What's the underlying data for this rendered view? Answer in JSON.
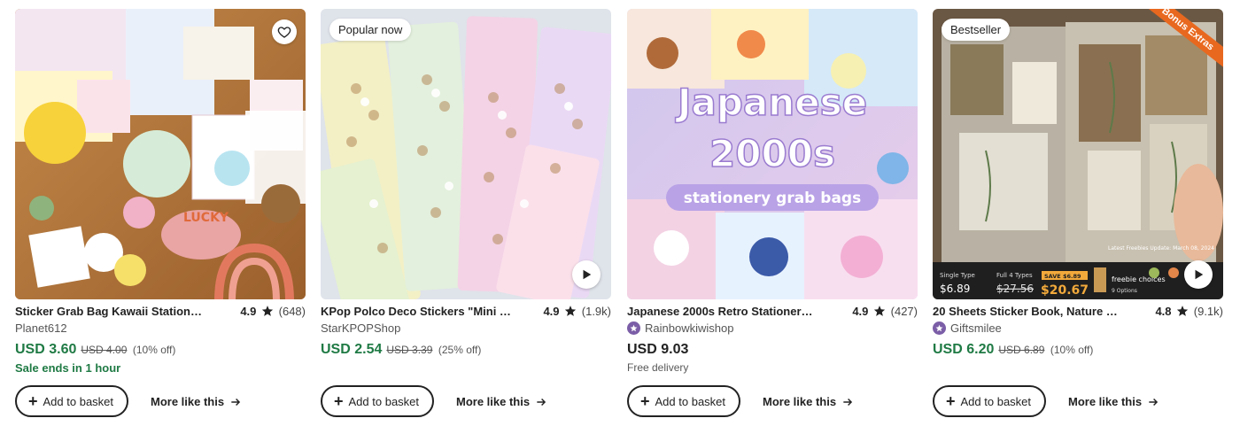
{
  "products": [
    {
      "badge": "",
      "has_favorite": true,
      "has_video": false,
      "ribbon": "",
      "title": "Sticker Grab Bag Kawaii Station…",
      "rating": "4.9",
      "review_count": "(648)",
      "shop": "Planet612",
      "star_seller": false,
      "price": "USD 3.60",
      "price_on_sale": true,
      "original_price": "USD 4.00",
      "discount": "(10% off)",
      "sub_text": "Sale ends in 1 hour",
      "sub_style": "green",
      "add_label": "Add to basket",
      "more_label": "More like this"
    },
    {
      "badge": "Popular now",
      "has_favorite": false,
      "has_video": true,
      "ribbon": "",
      "title": "KPop Polco Deco Stickers \"Mini …",
      "rating": "4.9",
      "review_count": "(1.9k)",
      "shop": "StarKPOPShop",
      "star_seller": false,
      "price": "USD 2.54",
      "price_on_sale": true,
      "original_price": "USD 3.39",
      "discount": "(25% off)",
      "sub_text": "",
      "sub_style": "",
      "add_label": "Add to basket",
      "more_label": "More like this"
    },
    {
      "badge": "",
      "has_favorite": false,
      "has_video": false,
      "ribbon": "",
      "title": "Japanese 2000s Retro Stationer…",
      "rating": "4.9",
      "review_count": "(427)",
      "shop": "Rainbowkiwishop",
      "star_seller": true,
      "price": "USD 9.03",
      "price_on_sale": false,
      "original_price": "",
      "discount": "",
      "sub_text": "Free delivery",
      "sub_style": "grey",
      "add_label": "Add to basket",
      "more_label": "More like this",
      "image_text": [
        "Japanese",
        "2000s",
        "stationery grab bags"
      ]
    },
    {
      "badge": "Bestseller",
      "has_favorite": false,
      "has_video": true,
      "ribbon": "Bonus Extras",
      "title": "20 Sheets Sticker Book, Nature …",
      "rating": "4.8",
      "review_count": "(9.1k)",
      "shop": "Giftsmilee",
      "star_seller": true,
      "price": "USD 6.20",
      "price_on_sale": true,
      "original_price": "USD 6.89",
      "discount": "(10% off)",
      "sub_text": "",
      "sub_style": "",
      "add_label": "Add to basket",
      "more_label": "More like this",
      "image_text": {
        "single_label": "Single Type",
        "single_price": "$6.89",
        "full_label": "Full 4 Types",
        "full_old": "$27.56",
        "save": "SAVE $6.89",
        "full_price": "$20.67",
        "freebie": "freebie choices",
        "freebie_sub": "9 Options",
        "update": "Latest Freebies Update: March 08, 2024"
      }
    }
  ],
  "colors": {
    "sale_green": "#1f7a44",
    "star_seller_purple": "#7b5ea7",
    "ribbon_orange": "#e8681f"
  }
}
